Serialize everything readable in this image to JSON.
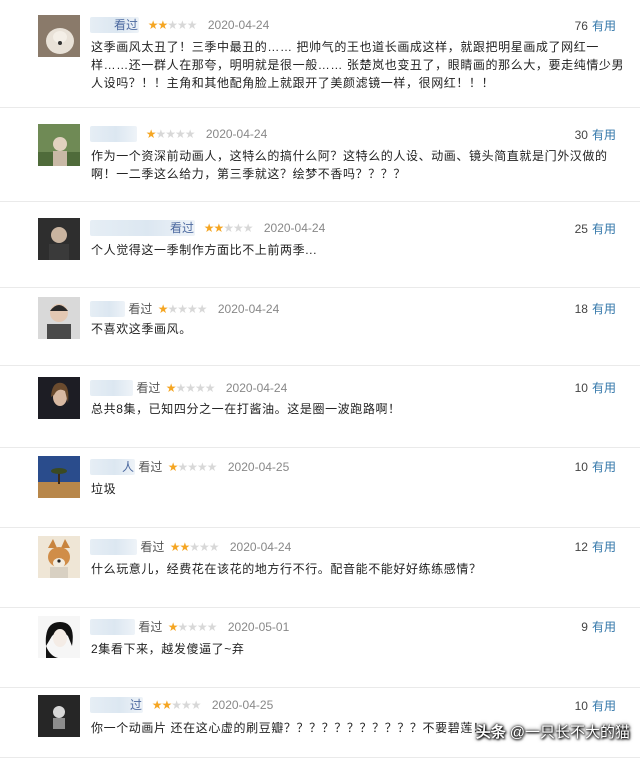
{
  "reviews": [
    {
      "user": "看过",
      "watched": "",
      "stars": 2,
      "date": "2020-04-24",
      "count": "76",
      "useful": "有用",
      "text": "这季画风太丑了！三季中最丑的…… 把帅气的王也道长画成这样，就跟把明星画成了网红一样……还一群人在那夸，明明就是很一般…… 张楚岚也变丑了，眼睛画的那么大，要走纯情少男人设吗？！！主角和其他配角脸上就跟开了美颜滤镜一样，很网红！！！",
      "avatar": "dog-white-icon"
    },
    {
      "user": "",
      "watched": "",
      "stars": 1,
      "date": "2020-04-24",
      "count": "30",
      "useful": "有用",
      "text": "作为一个资深前动画人，这特么的搞什么阿？这特么的人设、动画、镜头简直就是门外汉做的啊！一二季这么给力，第三季就这？绘梦不香吗？？？？",
      "avatar": "garden-person-icon"
    },
    {
      "user": "看过",
      "watched": "",
      "stars": 2,
      "date": "2020-04-24",
      "count": "25",
      "useful": "有用",
      "text": "个人觉得这一季制作方面比不上前两季...",
      "avatar": "person-dark-icon"
    },
    {
      "user": "",
      "watched": "看过",
      "stars": 1,
      "date": "2020-04-24",
      "count": "18",
      "useful": "有用",
      "text": "不喜欢这季画风。",
      "avatar": "person-portrait-icon"
    },
    {
      "user": "",
      "watched": "看过",
      "stars": 1,
      "date": "2020-04-24",
      "count": "10",
      "useful": "有用",
      "text": "总共8集，已知四分之一在打酱油。这是圈一波跑路啊！",
      "avatar": "woman-dark-icon"
    },
    {
      "user": "人",
      "watched": "看过",
      "stars": 1,
      "date": "2020-04-25",
      "count": "10",
      "useful": "有用",
      "text": "垃圾",
      "avatar": "desert-tree-icon"
    },
    {
      "user": "",
      "watched": "看过",
      "stars": 2,
      "date": "2020-04-24",
      "count": "12",
      "useful": "有用",
      "text": "什么玩意儿，经费花在该花的地方行不行。配音能不能好好练练感情？",
      "avatar": "shiba-dog-icon"
    },
    {
      "user": "",
      "watched": "看过",
      "stars": 1,
      "date": "2020-05-01",
      "count": "9",
      "useful": "有用",
      "text": "2集看下来，越发傻逼了~弃",
      "avatar": "anime-girl-icon"
    },
    {
      "user": "过",
      "watched": "",
      "stars": 2,
      "date": "2020-04-25",
      "count": "10",
      "useful": "有用",
      "text": "你一个动画片 还在这心虚的刷豆瓣？？？？？？？？？？？不要碧莲！",
      "avatar": "dark-figure-icon"
    }
  ],
  "watermark": {
    "logo": "头条",
    "text": "@一只长不大的猫"
  },
  "colors": {
    "star_on": "#f5a623",
    "star_off": "#d8d8d8",
    "link": "#3377aa"
  }
}
